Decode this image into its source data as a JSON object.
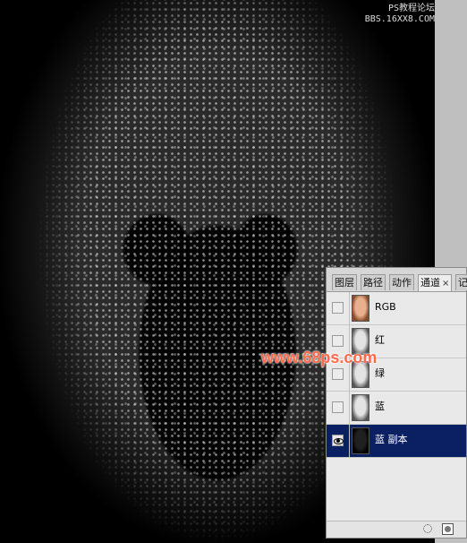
{
  "watermark_top": {
    "line1": "PS教程论坛",
    "line2": "BBS.16XX8.COM"
  },
  "watermark_center": "www.68ps.com",
  "panel": {
    "tabs": [
      {
        "label": "图层"
      },
      {
        "label": "路径"
      },
      {
        "label": "动作"
      },
      {
        "label": "通道",
        "active": true,
        "close": "×"
      },
      {
        "label": "记"
      }
    ],
    "channels": [
      {
        "label": "RGB",
        "visible": false,
        "thumb": "color"
      },
      {
        "label": "红",
        "visible": false,
        "thumb": "gray"
      },
      {
        "label": "绿",
        "visible": false,
        "thumb": "gray"
      },
      {
        "label": "蓝",
        "visible": false,
        "thumb": "gray"
      },
      {
        "label": "蓝 副本",
        "visible": true,
        "selected": true,
        "thumb": "dark"
      }
    ]
  },
  "icons": {
    "eye": "eye-icon",
    "load_selection": "dotted-circle-icon",
    "save_selection": "mask-icon"
  }
}
